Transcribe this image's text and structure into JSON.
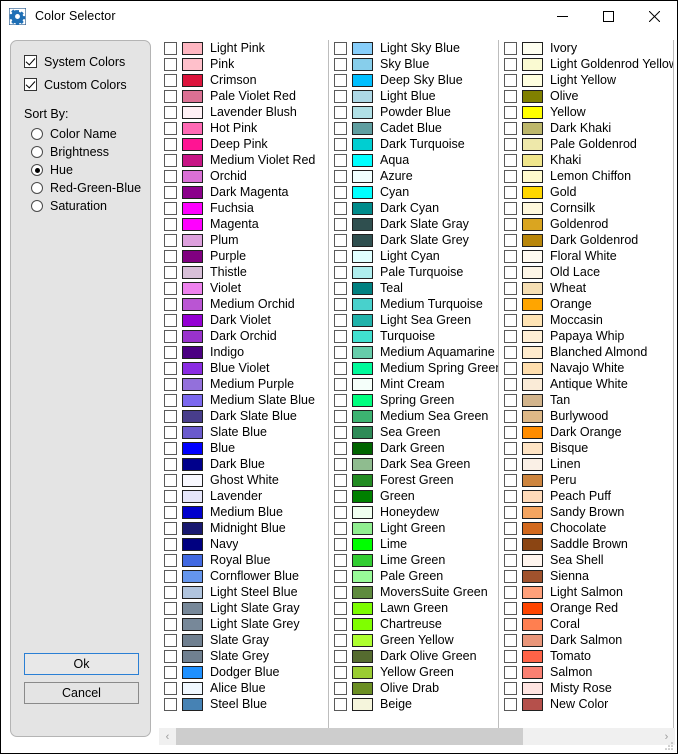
{
  "window": {
    "title": "Color Selector",
    "icon": "gear-icon",
    "minimize_label": "—",
    "maximize_label": "□",
    "close_label": "✕"
  },
  "options": {
    "checkboxes": [
      {
        "label": "System Colors",
        "checked": true
      },
      {
        "label": "Custom Colors",
        "checked": true
      }
    ],
    "sort_by_label": "Sort By:",
    "sort_options": [
      {
        "label": "Color Name",
        "selected": false
      },
      {
        "label": "Brightness",
        "selected": false
      },
      {
        "label": "Hue",
        "selected": true
      },
      {
        "label": "Red-Green-Blue",
        "selected": false
      },
      {
        "label": "Saturation",
        "selected": false
      }
    ],
    "ok_label": "Ok",
    "cancel_label": "Cancel"
  },
  "scrollbar": {
    "left_arrow": "‹",
    "right_arrow": "›",
    "thumb_percent": 72
  },
  "columns": [
    {
      "colors": [
        {
          "name": "Light Pink",
          "hex": "#FFB6C1",
          "checked": false
        },
        {
          "name": "Pink",
          "hex": "#FFC0CB",
          "checked": false
        },
        {
          "name": "Crimson",
          "hex": "#DC143C",
          "checked": false
        },
        {
          "name": "Pale Violet Red",
          "hex": "#DB7093",
          "checked": false
        },
        {
          "name": "Lavender Blush",
          "hex": "#FFF0F5",
          "checked": false
        },
        {
          "name": "Hot Pink",
          "hex": "#FF69B4",
          "checked": false
        },
        {
          "name": "Deep Pink",
          "hex": "#FF1493",
          "checked": false
        },
        {
          "name": "Medium Violet Red",
          "hex": "#C71585",
          "checked": false
        },
        {
          "name": "Orchid",
          "hex": "#DA70D6",
          "checked": false
        },
        {
          "name": "Dark Magenta",
          "hex": "#8B008B",
          "checked": false
        },
        {
          "name": "Fuchsia",
          "hex": "#FF00FF",
          "checked": false
        },
        {
          "name": "Magenta",
          "hex": "#FF00FF",
          "checked": false
        },
        {
          "name": "Plum",
          "hex": "#DDA0DD",
          "checked": false
        },
        {
          "name": "Purple",
          "hex": "#800080",
          "checked": false
        },
        {
          "name": "Thistle",
          "hex": "#D8BFD8",
          "checked": false
        },
        {
          "name": "Violet",
          "hex": "#EE82EE",
          "checked": false
        },
        {
          "name": "Medium Orchid",
          "hex": "#BA55D3",
          "checked": false
        },
        {
          "name": "Dark Violet",
          "hex": "#9400D3",
          "checked": false
        },
        {
          "name": "Dark Orchid",
          "hex": "#9932CC",
          "checked": false
        },
        {
          "name": "Indigo",
          "hex": "#4B0082",
          "checked": false
        },
        {
          "name": "Blue Violet",
          "hex": "#8A2BE2",
          "checked": false
        },
        {
          "name": "Medium Purple",
          "hex": "#9370DB",
          "checked": false
        },
        {
          "name": "Medium Slate Blue",
          "hex": "#7B68EE",
          "checked": false
        },
        {
          "name": "Dark Slate Blue",
          "hex": "#483D8B",
          "checked": false
        },
        {
          "name": "Slate Blue",
          "hex": "#6A5ACD",
          "checked": false
        },
        {
          "name": "Blue",
          "hex": "#0000FF",
          "checked": false
        },
        {
          "name": "Dark Blue",
          "hex": "#00008B",
          "checked": false
        },
        {
          "name": "Ghost White",
          "hex": "#F8F8FF",
          "checked": false
        },
        {
          "name": "Lavender",
          "hex": "#E6E6FA",
          "checked": false
        },
        {
          "name": "Medium Blue",
          "hex": "#0000CD",
          "checked": false
        },
        {
          "name": "Midnight Blue",
          "hex": "#191970",
          "checked": false
        },
        {
          "name": "Navy",
          "hex": "#000080",
          "checked": false
        },
        {
          "name": "Royal Blue",
          "hex": "#4169E1",
          "checked": false
        },
        {
          "name": "Cornflower Blue",
          "hex": "#6495ED",
          "checked": false
        },
        {
          "name": "Light Steel Blue",
          "hex": "#B0C4DE",
          "checked": false
        },
        {
          "name": "Light Slate Gray",
          "hex": "#778899",
          "checked": false
        },
        {
          "name": "Light Slate Grey",
          "hex": "#778899",
          "checked": false
        },
        {
          "name": "Slate Gray",
          "hex": "#708090",
          "checked": false
        },
        {
          "name": "Slate Grey",
          "hex": "#708090",
          "checked": false
        },
        {
          "name": "Dodger Blue",
          "hex": "#1E90FF",
          "checked": false
        },
        {
          "name": "Alice Blue",
          "hex": "#F0F8FF",
          "checked": false
        },
        {
          "name": "Steel Blue",
          "hex": "#4682B4",
          "checked": false
        }
      ]
    },
    {
      "colors": [
        {
          "name": "Light Sky Blue",
          "hex": "#87CEFA",
          "checked": false
        },
        {
          "name": "Sky Blue",
          "hex": "#87CEEB",
          "checked": false
        },
        {
          "name": "Deep Sky Blue",
          "hex": "#00BFFF",
          "checked": false
        },
        {
          "name": "Light Blue",
          "hex": "#ADD8E6",
          "checked": false
        },
        {
          "name": "Powder Blue",
          "hex": "#B0E0E6",
          "checked": false
        },
        {
          "name": "Cadet Blue",
          "hex": "#5F9EA0",
          "checked": false
        },
        {
          "name": "Dark Turquoise",
          "hex": "#00CED1",
          "checked": false
        },
        {
          "name": "Aqua",
          "hex": "#00FFFF",
          "checked": false
        },
        {
          "name": "Azure",
          "hex": "#F0FFFF",
          "checked": false
        },
        {
          "name": "Cyan",
          "hex": "#00FFFF",
          "checked": false
        },
        {
          "name": "Dark Cyan",
          "hex": "#008B8B",
          "checked": false
        },
        {
          "name": "Dark Slate Gray",
          "hex": "#2F4F4F",
          "checked": false
        },
        {
          "name": "Dark Slate Grey",
          "hex": "#2F4F4F",
          "checked": false
        },
        {
          "name": "Light Cyan",
          "hex": "#E0FFFF",
          "checked": false
        },
        {
          "name": "Pale Turquoise",
          "hex": "#AFEEEE",
          "checked": false
        },
        {
          "name": "Teal",
          "hex": "#008080",
          "checked": false
        },
        {
          "name": "Medium Turquoise",
          "hex": "#48D1CC",
          "checked": false
        },
        {
          "name": "Light Sea Green",
          "hex": "#20B2AA",
          "checked": false
        },
        {
          "name": "Turquoise",
          "hex": "#40E0D0",
          "checked": false
        },
        {
          "name": "Medium Aquamarine",
          "hex": "#66CDAA",
          "checked": false
        },
        {
          "name": "Medium Spring Green",
          "hex": "#00FA9A",
          "checked": false
        },
        {
          "name": "Mint Cream",
          "hex": "#F5FFFA",
          "checked": false
        },
        {
          "name": "Spring Green",
          "hex": "#00FF7F",
          "checked": false
        },
        {
          "name": "Medium Sea Green",
          "hex": "#3CB371",
          "checked": false
        },
        {
          "name": "Sea Green",
          "hex": "#2E8B57",
          "checked": false
        },
        {
          "name": "Dark Green",
          "hex": "#006400",
          "checked": false
        },
        {
          "name": "Dark Sea Green",
          "hex": "#8FBC8F",
          "checked": false
        },
        {
          "name": "Forest Green",
          "hex": "#228B22",
          "checked": false
        },
        {
          "name": "Green",
          "hex": "#008000",
          "checked": false
        },
        {
          "name": "Honeydew",
          "hex": "#F0FFF0",
          "checked": false
        },
        {
          "name": "Light Green",
          "hex": "#90EE90",
          "checked": false
        },
        {
          "name": "Lime",
          "hex": "#00FF00",
          "checked": false
        },
        {
          "name": "Lime Green",
          "hex": "#32CD32",
          "checked": false
        },
        {
          "name": "Pale Green",
          "hex": "#98FB98",
          "checked": false
        },
        {
          "name": "MoversSuite Green",
          "hex": "#5E8B3D",
          "checked": false
        },
        {
          "name": "Lawn Green",
          "hex": "#7CFC00",
          "checked": false
        },
        {
          "name": "Chartreuse",
          "hex": "#7FFF00",
          "checked": false
        },
        {
          "name": "Green Yellow",
          "hex": "#ADFF2F",
          "checked": false
        },
        {
          "name": "Dark Olive Green",
          "hex": "#556B2F",
          "checked": false
        },
        {
          "name": "Yellow Green",
          "hex": "#9ACD32",
          "checked": false
        },
        {
          "name": "Olive Drab",
          "hex": "#6B8E23",
          "checked": false
        },
        {
          "name": "Beige",
          "hex": "#F5F5DC",
          "checked": false
        }
      ]
    },
    {
      "colors": [
        {
          "name": "Ivory",
          "hex": "#FFFFF0",
          "checked": false
        },
        {
          "name": "Light Goldenrod Yellow",
          "hex": "#FAFAD2",
          "checked": false
        },
        {
          "name": "Light Yellow",
          "hex": "#FFFFE0",
          "checked": false
        },
        {
          "name": "Olive",
          "hex": "#808000",
          "checked": false
        },
        {
          "name": "Yellow",
          "hex": "#FFFF00",
          "checked": false
        },
        {
          "name": "Dark Khaki",
          "hex": "#BDB76B",
          "checked": false
        },
        {
          "name": "Pale Goldenrod",
          "hex": "#EEE8AA",
          "checked": false
        },
        {
          "name": "Khaki",
          "hex": "#F0E68C",
          "checked": false
        },
        {
          "name": "Lemon Chiffon",
          "hex": "#FFFACD",
          "checked": false
        },
        {
          "name": "Gold",
          "hex": "#FFD700",
          "checked": false
        },
        {
          "name": "Cornsilk",
          "hex": "#FFF8DC",
          "checked": false
        },
        {
          "name": "Goldenrod",
          "hex": "#DAA520",
          "checked": false
        },
        {
          "name": "Dark Goldenrod",
          "hex": "#B8860B",
          "checked": false
        },
        {
          "name": "Floral White",
          "hex": "#FFFAF0",
          "checked": false
        },
        {
          "name": "Old Lace",
          "hex": "#FDF5E6",
          "checked": false
        },
        {
          "name": "Wheat",
          "hex": "#F5DEB3",
          "checked": false
        },
        {
          "name": "Orange",
          "hex": "#FFA500",
          "checked": false
        },
        {
          "name": "Moccasin",
          "hex": "#FFE4B5",
          "checked": false
        },
        {
          "name": "Papaya Whip",
          "hex": "#FFEFD5",
          "checked": false
        },
        {
          "name": "Blanched Almond",
          "hex": "#FFEBCD",
          "checked": false
        },
        {
          "name": "Navajo White",
          "hex": "#FFDEAD",
          "checked": false
        },
        {
          "name": "Antique White",
          "hex": "#FAEBD7",
          "checked": false
        },
        {
          "name": "Tan",
          "hex": "#D2B48C",
          "checked": false
        },
        {
          "name": "Burlywood",
          "hex": "#DEB887",
          "checked": false
        },
        {
          "name": "Dark Orange",
          "hex": "#FF8C00",
          "checked": false
        },
        {
          "name": "Bisque",
          "hex": "#FFE4C4",
          "checked": false
        },
        {
          "name": "Linen",
          "hex": "#FAF0E6",
          "checked": false
        },
        {
          "name": "Peru",
          "hex": "#CD853F",
          "checked": false
        },
        {
          "name": "Peach Puff",
          "hex": "#FFDAB9",
          "checked": false
        },
        {
          "name": "Sandy Brown",
          "hex": "#F4A460",
          "checked": false
        },
        {
          "name": "Chocolate",
          "hex": "#D2691E",
          "checked": false
        },
        {
          "name": "Saddle Brown",
          "hex": "#8B4513",
          "checked": false
        },
        {
          "name": "Sea Shell",
          "hex": "#FFF5EE",
          "checked": false
        },
        {
          "name": "Sienna",
          "hex": "#A0522D",
          "checked": false
        },
        {
          "name": "Light Salmon",
          "hex": "#FFA07A",
          "checked": false
        },
        {
          "name": "Orange Red",
          "hex": "#FF4500",
          "checked": false
        },
        {
          "name": "Coral",
          "hex": "#FF7F50",
          "checked": false
        },
        {
          "name": "Dark Salmon",
          "hex": "#E9967A",
          "checked": false
        },
        {
          "name": "Tomato",
          "hex": "#FF6347",
          "checked": false
        },
        {
          "name": "Salmon",
          "hex": "#FA8072",
          "checked": false
        },
        {
          "name": "Misty Rose",
          "hex": "#FFE4E1",
          "checked": false
        },
        {
          "name": "New Color",
          "hex": "#B5504B",
          "checked": false
        }
      ]
    }
  ]
}
